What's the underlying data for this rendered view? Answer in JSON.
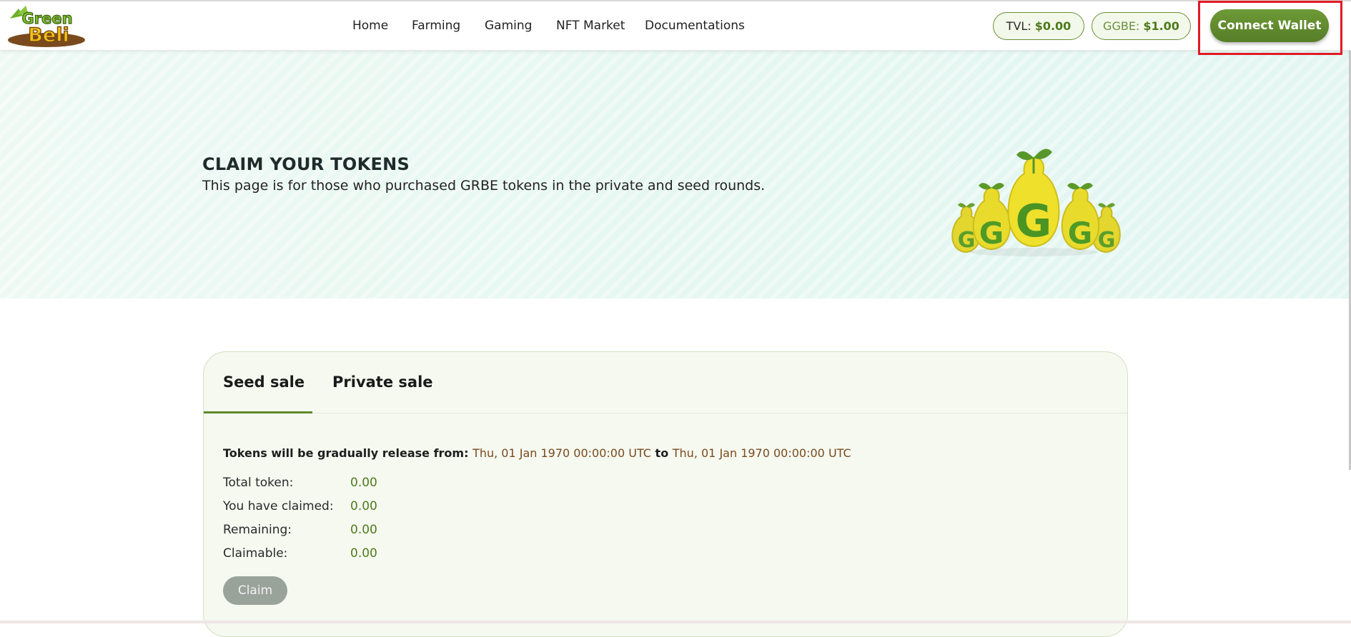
{
  "header": {
    "logo_text": "Green Beli",
    "nav": [
      {
        "label": "Home"
      },
      {
        "label": "Farming"
      },
      {
        "label": "Gaming"
      },
      {
        "label": "NFT Market"
      },
      {
        "label": "Documentations"
      }
    ],
    "tvl": {
      "label": "TVL:",
      "value": "$0.00"
    },
    "ggbe": {
      "label": "GGBE:",
      "value": "$1.00"
    },
    "connect_label": "Connect Wallet"
  },
  "hero": {
    "title": "CLAIM YOUR TOKENS",
    "subtitle": "This page is for those who purchased GRBE tokens in the private and seed rounds."
  },
  "card": {
    "tabs": [
      {
        "label": "Seed sale",
        "active": true
      },
      {
        "label": "Private sale",
        "active": false
      }
    ],
    "release": {
      "prefix": "Tokens will be gradually release from:",
      "from": "Thu, 01 Jan 1970 00:00:00 UTC",
      "connector": "to",
      "to": "Thu, 01 Jan 1970 00:00:00 UTC"
    },
    "rows": [
      {
        "label": "Total token:",
        "value": "0.00"
      },
      {
        "label": "You have claimed:",
        "value": "0.00"
      },
      {
        "label": "Remaining:",
        "value": "0.00"
      },
      {
        "label": "Claimable:",
        "value": "0.00"
      }
    ],
    "claim_label": "Claim"
  },
  "colors": {
    "accent": "#5f8a2b",
    "value_green": "#4f7a1c",
    "date_brown": "#7a4a1e",
    "highlight_red": "#e01b24"
  }
}
